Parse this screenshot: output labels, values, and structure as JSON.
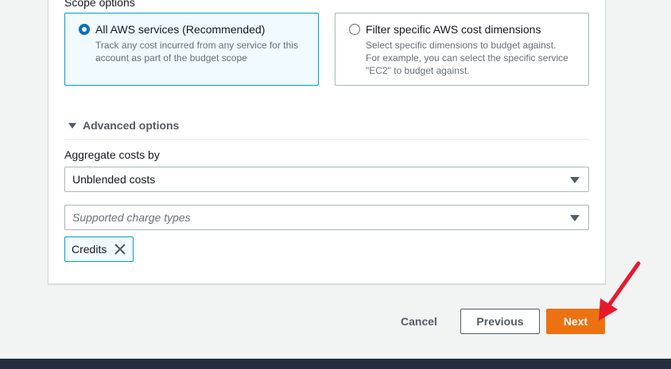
{
  "scope": {
    "label": "Scope options",
    "option_all": {
      "title": "All AWS services (Recommended)",
      "desc_line1": "Track any cost incurred from any service for this",
      "desc_line2": "account as part of the budget scope"
    },
    "option_filter": {
      "title": "Filter specific AWS cost dimensions",
      "desc_line1": "Select specific dimensions to budget against.",
      "desc_line2": "For example, you can select the specific service",
      "desc_line3": "\"EC2\" to budget against."
    }
  },
  "advanced": {
    "title": "Advanced options",
    "aggregate_label": "Aggregate costs by",
    "aggregate_value": "Unblended costs",
    "charge_types_placeholder": "Supported charge types",
    "tokens": [
      "Credits"
    ]
  },
  "actions": {
    "cancel": "Cancel",
    "previous": "Previous",
    "next": "Next"
  },
  "colors": {
    "primary": "#ec7211",
    "selected_border": "#00a1c9",
    "radio_selected": "#0073bb",
    "annotation_arrow": "#e8192c",
    "footer": "#232f3e"
  }
}
